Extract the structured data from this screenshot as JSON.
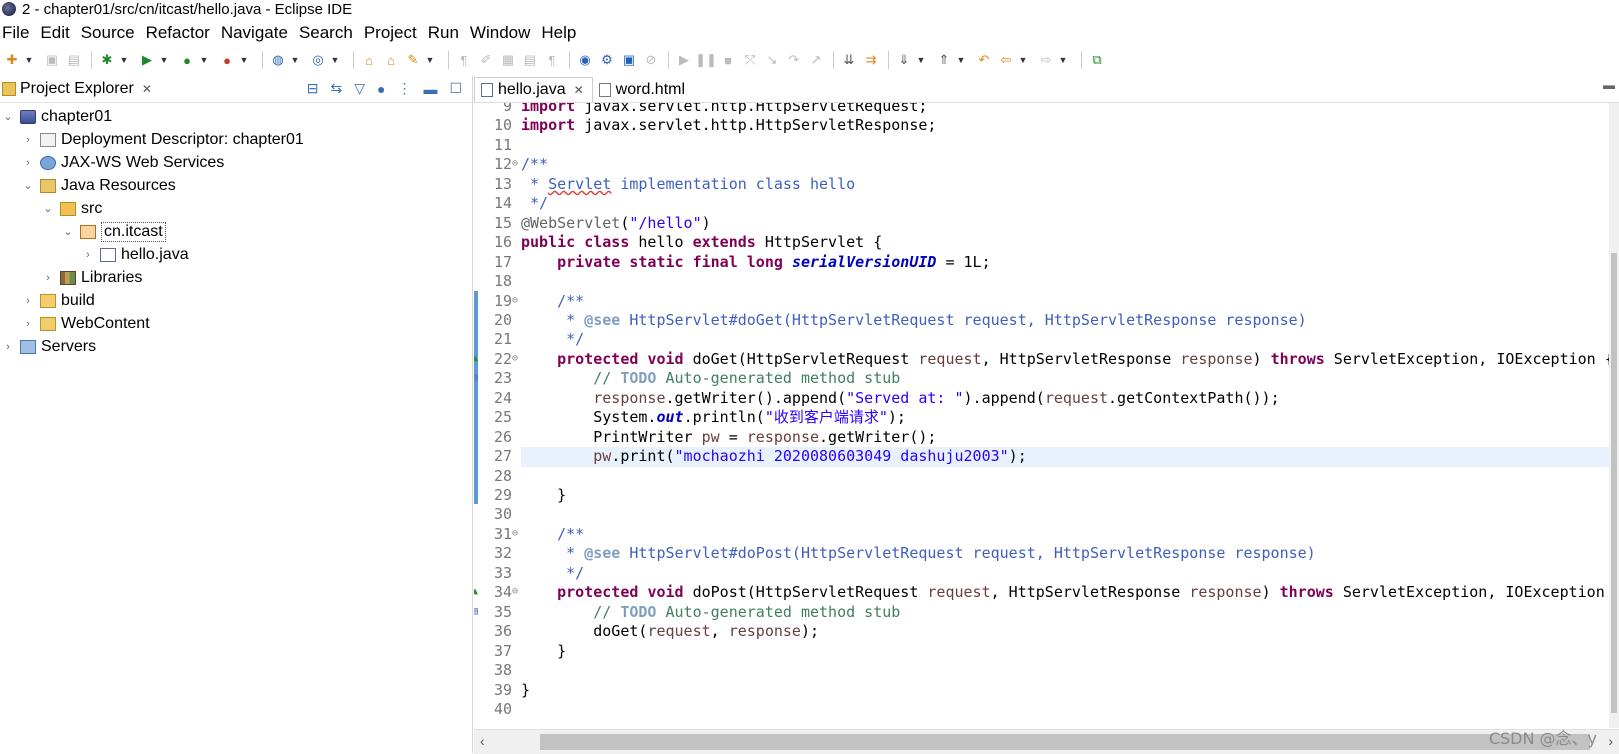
{
  "window": {
    "title": "2 - chapter01/src/cn/itcast/hello.java - Eclipse IDE"
  },
  "menu": [
    "File",
    "Edit",
    "Source",
    "Refactor",
    "Navigate",
    "Search",
    "Project",
    "Run",
    "Window",
    "Help"
  ],
  "project_explorer": {
    "tab_label": "Project Explorer",
    "tree": [
      {
        "label": "chapter01",
        "icon": "project-icon"
      },
      {
        "label": "Deployment Descriptor: chapter01",
        "icon": "deployment-descriptor-icon"
      },
      {
        "label": "JAX-WS Web Services",
        "icon": "web-services-icon"
      },
      {
        "label": "Java Resources",
        "icon": "java-resources-icon"
      },
      {
        "label": "src",
        "icon": "source-folder-icon"
      },
      {
        "label": "cn.itcast",
        "icon": "package-icon"
      },
      {
        "label": "hello.java",
        "icon": "java-file-icon"
      },
      {
        "label": "Libraries",
        "icon": "libraries-icon"
      },
      {
        "label": "build",
        "icon": "folder-icon"
      },
      {
        "label": "WebContent",
        "icon": "folder-icon"
      },
      {
        "label": "Servers",
        "icon": "servers-icon"
      }
    ]
  },
  "editor": {
    "tabs": [
      {
        "label": "hello.java",
        "active": true
      },
      {
        "label": "word.html",
        "active": false
      }
    ],
    "lines": [
      {
        "n": "9",
        "t": "import javax.servlet.http.HttpServletRequest;"
      },
      {
        "n": "10",
        "t": "import javax.servlet.http.HttpServletResponse;"
      },
      {
        "n": "11",
        "t": ""
      },
      {
        "n": "12",
        "t": "/**"
      },
      {
        "n": "13",
        "t": " * Servlet implementation class hello"
      },
      {
        "n": "14",
        "t": " */"
      },
      {
        "n": "15",
        "t": "@WebServlet(\"/hello\")"
      },
      {
        "n": "16",
        "t": "public class hello extends HttpServlet {"
      },
      {
        "n": "17",
        "t": "    private static final long serialVersionUID = 1L;"
      },
      {
        "n": "18",
        "t": ""
      },
      {
        "n": "19",
        "t": "    /**"
      },
      {
        "n": "20",
        "t": "     * @see HttpServlet#doGet(HttpServletRequest request, HttpServletResponse response)"
      },
      {
        "n": "21",
        "t": "     */"
      },
      {
        "n": "22",
        "t": "    protected void doGet(HttpServletRequest request, HttpServletResponse response) throws ServletException, IOException {"
      },
      {
        "n": "23",
        "t": "        // TODO Auto-generated method stub"
      },
      {
        "n": "24",
        "t": "        response.getWriter().append(\"Served at: \").append(request.getContextPath());"
      },
      {
        "n": "25",
        "t": "        System.out.println(\"收到客户端请求\");"
      },
      {
        "n": "26",
        "t": "        PrintWriter pw = response.getWriter();"
      },
      {
        "n": "27",
        "t": "        pw.print(\"mochaozhi 2020080603049 dashuju2003\");"
      },
      {
        "n": "28",
        "t": ""
      },
      {
        "n": "29",
        "t": "    }"
      },
      {
        "n": "30",
        "t": ""
      },
      {
        "n": "31",
        "t": "    /**"
      },
      {
        "n": "32",
        "t": "     * @see HttpServlet#doPost(HttpServletRequest request, HttpServletResponse response)"
      },
      {
        "n": "33",
        "t": "     */"
      },
      {
        "n": "34",
        "t": "    protected void doPost(HttpServletRequest request, HttpServletResponse response) throws ServletException, IOException"
      },
      {
        "n": "35",
        "t": "        // TODO Auto-generated method stub"
      },
      {
        "n": "36",
        "t": "        doGet(request, response);"
      },
      {
        "n": "37",
        "t": "    }"
      },
      {
        "n": "38",
        "t": ""
      },
      {
        "n": "39",
        "t": "}"
      },
      {
        "n": "40",
        "t": ""
      }
    ]
  },
  "watermark": "CSDN @念、y"
}
